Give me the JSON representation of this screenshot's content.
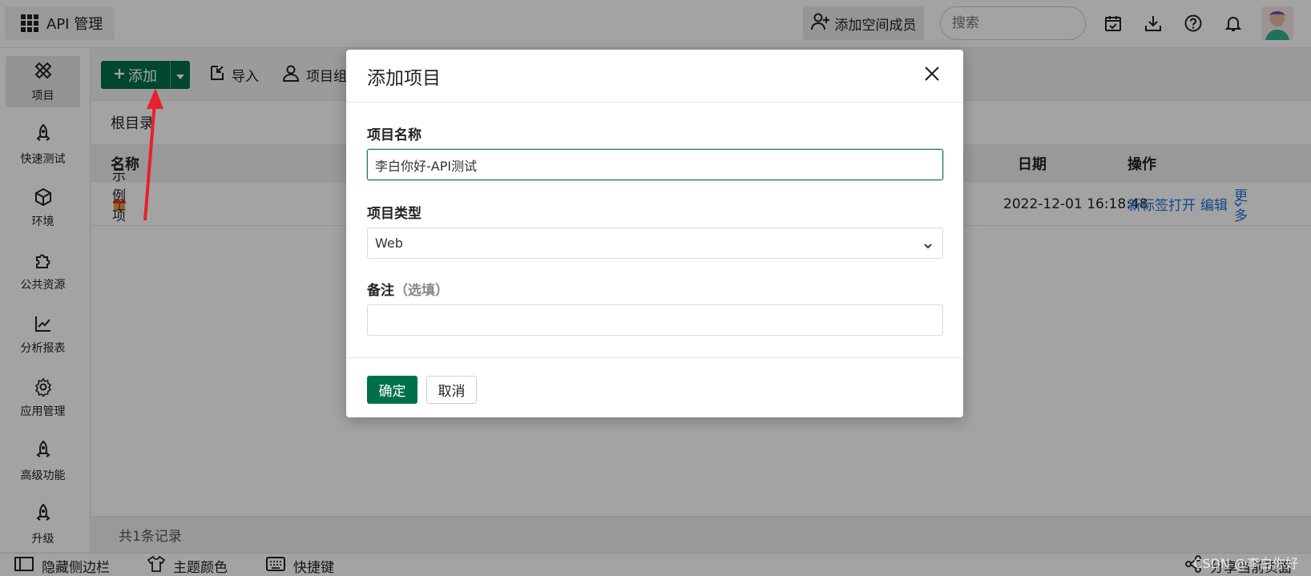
{
  "topbar": {
    "app_name": "API 管理",
    "add_member_label": "添加空间成员",
    "search_placeholder": "搜索"
  },
  "sidebar": {
    "items": [
      {
        "label": "项目",
        "icon": "project-icon"
      },
      {
        "label": "快速测试",
        "icon": "rocket-icon"
      },
      {
        "label": "环境",
        "icon": "cube-icon"
      },
      {
        "label": "公共资源",
        "icon": "puzzle-icon"
      },
      {
        "label": "分析报表",
        "icon": "chart-icon"
      },
      {
        "label": "应用管理",
        "icon": "gear-icon"
      },
      {
        "label": "高级功能",
        "icon": "rocket-icon"
      },
      {
        "label": "升级",
        "icon": "rocket-icon"
      }
    ]
  },
  "toolbar": {
    "add_label": "添加",
    "import_label": "导入",
    "project_group_label": "项目组"
  },
  "breadcrumb": "根目录",
  "table": {
    "columns": {
      "name": "名称",
      "date": "日期",
      "actions": "操作"
    },
    "rows": [
      {
        "name": "示例项目",
        "date": "2022-12-01 16:18:48",
        "action_open": "新标签打开",
        "action_edit": "编辑",
        "action_more": "更多"
      }
    ]
  },
  "footer": {
    "record_count": "共1条记录"
  },
  "bottombar": {
    "hide_sidebar": "隐藏侧边栏",
    "theme_color": "主题颜色",
    "shortcuts": "快捷键",
    "share_page": "分享当前页面"
  },
  "modal": {
    "title": "添加项目",
    "name_label": "项目名称",
    "name_value": "李白你好-API测试",
    "type_label": "项目类型",
    "type_value": "Web",
    "note_label": "备注",
    "note_optional": "（选填）",
    "note_value": "",
    "confirm_label": "确定",
    "cancel_label": "取消"
  },
  "watermark": "CSDN @李白你好",
  "colors": {
    "primary": "#00704a",
    "link": "#1e6fd9",
    "annotation_arrow": "#e8202a"
  }
}
